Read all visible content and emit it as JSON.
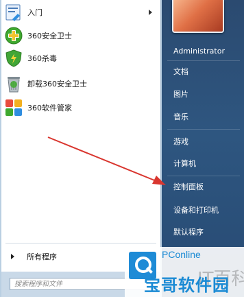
{
  "left_panel": {
    "programs": [
      {
        "label": "入门",
        "icon": "getting-started-icon",
        "has_submenu": true
      },
      {
        "label": "360安全卫士",
        "icon": "360-safeguard-icon"
      },
      {
        "label": "360杀毒",
        "icon": "360-antivirus-icon"
      },
      {
        "label": "卸载360安全卫士",
        "icon": "uninstall-icon"
      },
      {
        "label": "360软件管家",
        "icon": "360-software-manager-icon"
      }
    ],
    "all_programs": "所有程序",
    "search_placeholder": "搜索程序和文件"
  },
  "right_panel": {
    "user_name": "Administrator",
    "items": [
      "文档",
      "图片",
      "音乐",
      "游戏",
      "计算机",
      "控制面板",
      "设备和打印机",
      "默认程序"
    ]
  },
  "watermark": {
    "brand": "PConline",
    "text": "宝哥软件园",
    "shadow_text": "IT百科"
  },
  "colors": {
    "right_panel_bg": "#2e5680",
    "arrow": "#d9362f",
    "watermark_blue": "#1a8ad4"
  }
}
